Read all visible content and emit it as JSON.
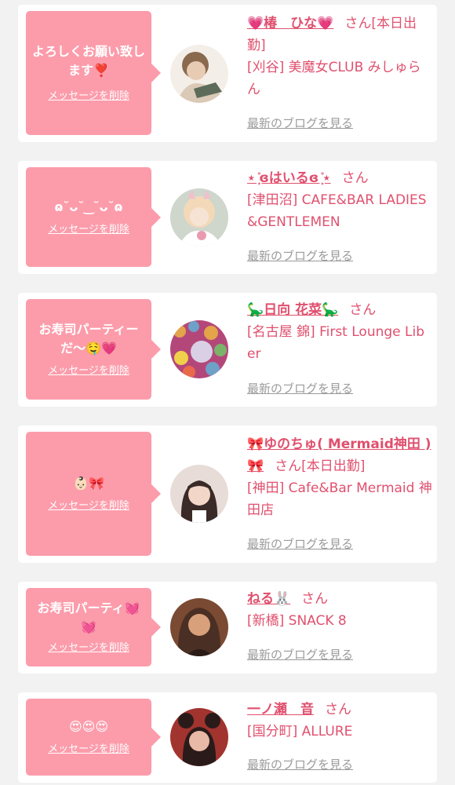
{
  "messages": [
    {
      "bubble_text": "よろしくお願い致します❣️",
      "delete_label": "メッセージを削除",
      "cast_name": "💗椿　ひな💗",
      "san": "さん",
      "status": "[本日出勤]",
      "shop": "[刈谷] 美魔女CLUB みしゅらん",
      "blog_label": "最新のブログを見る",
      "avatar_colors": [
        "#d9c9b6",
        "#8a6a4e",
        "#f4eee8"
      ]
    },
    {
      "bubble_text": "ɷ˘ᴗ˘ ͜ ˘ᴗ˘ɷ",
      "delete_label": "メッセージを削除",
      "cast_name": "⋆ ͙̊ɞはいるɞ ͙̊⋆",
      "san": "さん",
      "status": "",
      "shop": "[津田沼] CAFE&BAR LADIES&GENTLEMEN",
      "blog_label": "最新のブログを見る",
      "avatar_colors": [
        "#cfd6cc",
        "#f3d9b8",
        "#f0c0cc"
      ]
    },
    {
      "bubble_text": "お寿司パーティーだ〜🤤💗",
      "delete_label": "メッセージを削除",
      "cast_name": "🦕日向 花菜🦕",
      "san": "さん",
      "status": "",
      "shop": "[名古屋 錦] First Lounge Liber",
      "blog_label": "最新のブログを見る",
      "avatar_colors": [
        "#b4477a",
        "#e3a44a",
        "#d9d0e6"
      ]
    },
    {
      "bubble_text": "👶🏻🎀",
      "delete_label": "メッセージを削除",
      "cast_name": "🎀ゆのちゅ( Mermaid神田 )🎀",
      "san": "さん",
      "status": "[本日出勤]",
      "shop": "[神田] Cafe&Bar Mermaid 神田店",
      "blog_label": "最新のブログを見る",
      "avatar_colors": [
        "#e7dcd7",
        "#3a2a28",
        "#f2d6c8"
      ]
    },
    {
      "bubble_text": "お寿司パーティ💓💓",
      "delete_label": "メッセージを削除",
      "cast_name": "ねる🐰",
      "san": "さん",
      "status": "",
      "shop": "[新橋] SNACK 8",
      "blog_label": "最新のブログを見る",
      "avatar_colors": [
        "#4a2f24",
        "#d9a07c",
        "#7a4a32"
      ]
    },
    {
      "bubble_text": "😍😍😍",
      "delete_label": "メッセージを削除",
      "cast_name": "一ノ瀬　音",
      "san": "さん",
      "status": "",
      "shop": "[国分町] ALLURE",
      "blog_label": "最新のブログを見る",
      "avatar_colors": [
        "#a1342e",
        "#2a1b1a",
        "#e8b9a6"
      ]
    }
  ]
}
